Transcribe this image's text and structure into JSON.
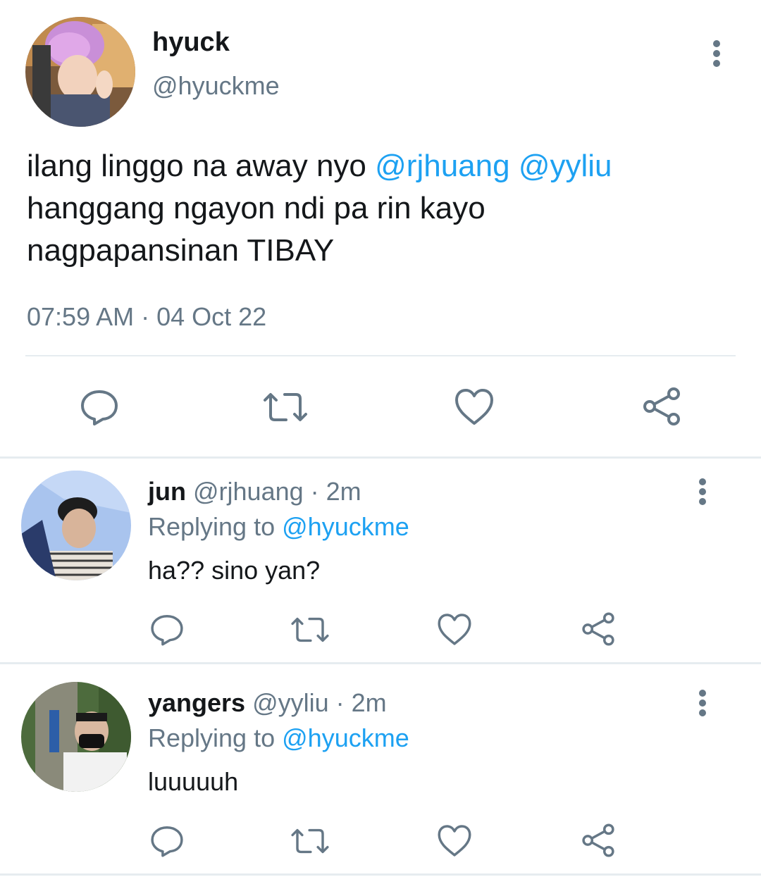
{
  "main_tweet": {
    "display_name": "hyuck",
    "handle": "@hyuckme",
    "text_parts": {
      "line1_start": "ilang linggo na away nyo ",
      "mention1": "@rjhuang",
      "mention2": "@yyliu",
      "line2": "hanggang ngayon ndi pa rin kayo",
      "line3": "nagpapansinan TIBAY"
    },
    "timestamp": "07:59 AM · 04 Oct 22"
  },
  "replies": [
    {
      "display_name": "jun",
      "handle": "@rjhuang",
      "time": "· 2m",
      "replying_label": "Replying to",
      "replying_to": "@hyuckme",
      "text": "ha?? sino yan?"
    },
    {
      "display_name": "yangers",
      "handle": "@yyliu",
      "time": "· 2m",
      "replying_label": "Replying to",
      "replying_to": "@hyuckme",
      "text": "luuuuuh"
    }
  ],
  "icons": [
    "more-vertical-icon",
    "reply-icon",
    "retweet-icon",
    "like-icon",
    "share-icon"
  ],
  "colors": {
    "link": "#1da1f2",
    "muted": "#657786",
    "icon": "#657786",
    "divider": "#e6ecf0"
  }
}
